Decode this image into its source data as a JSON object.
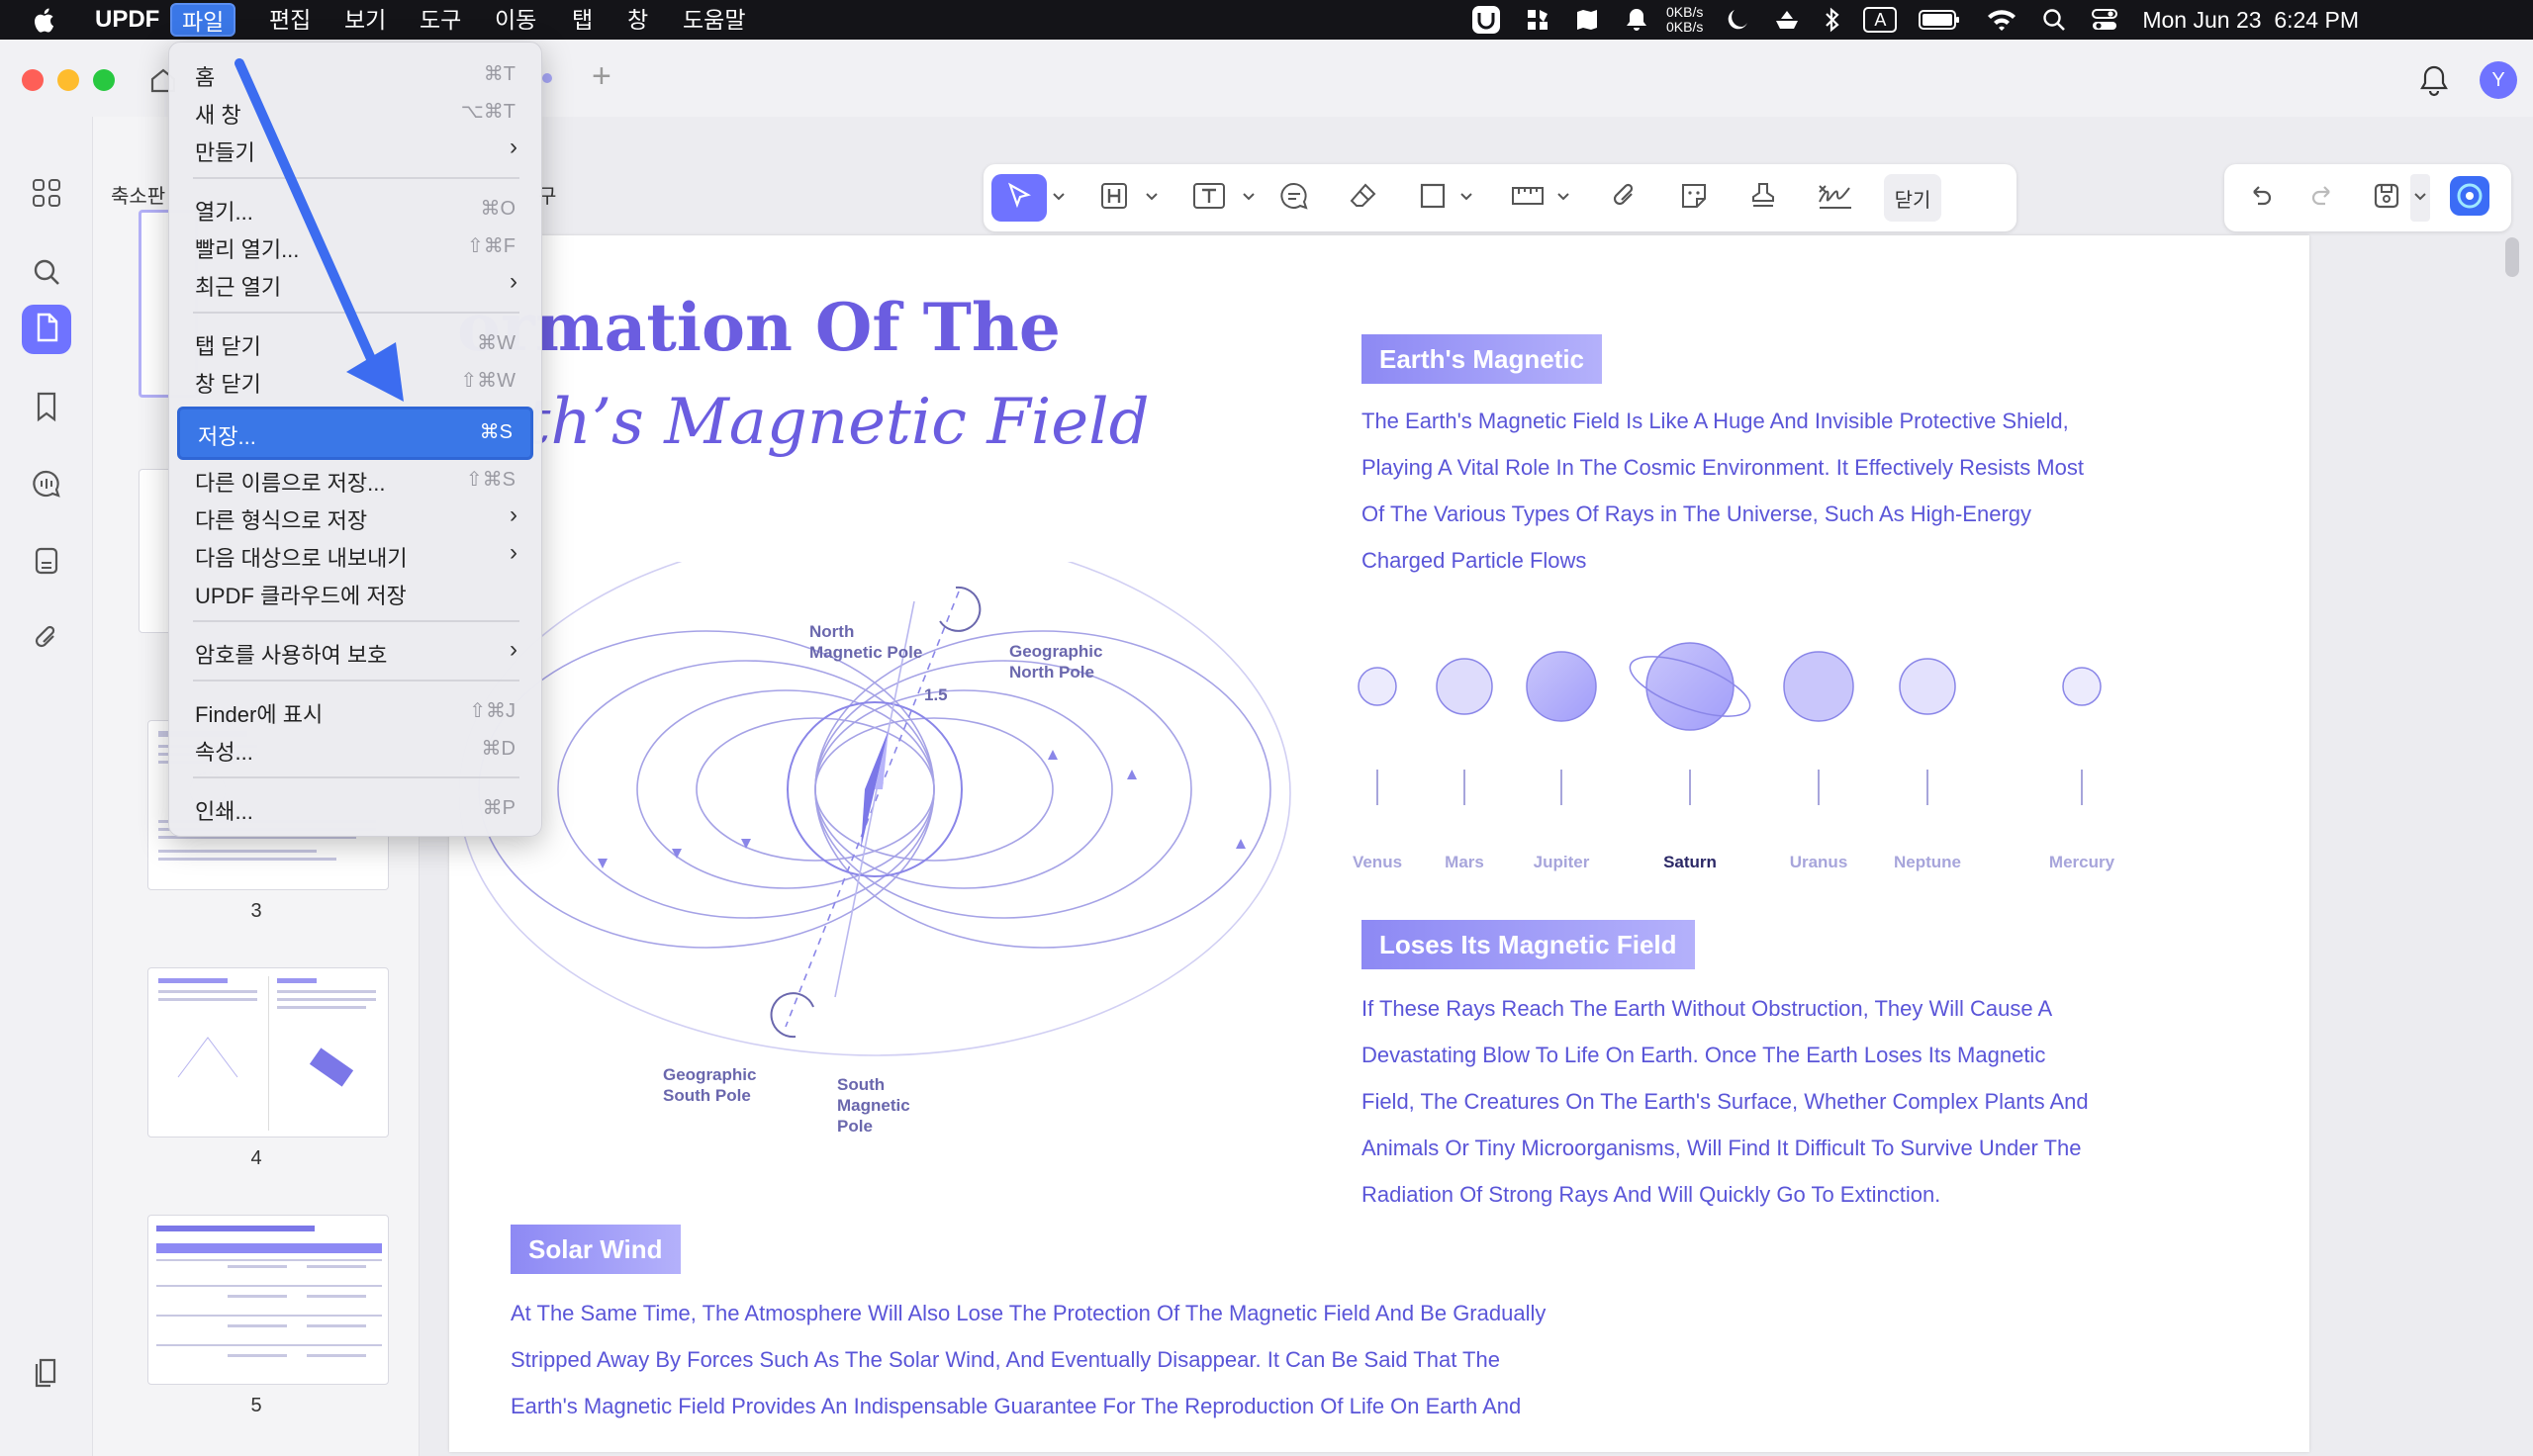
{
  "menubar": {
    "app_name": "UPDF",
    "menus": [
      "파일",
      "편집",
      "보기",
      "도구",
      "이동",
      "탭",
      "창",
      "도움말"
    ],
    "network_up": "0KB/s",
    "network_down": "0KB/s",
    "input_source": "A",
    "clock": "Mon Jun 23  6:24 PM"
  },
  "window": {
    "avatar_letter": "Y",
    "thumbs_label": "축소판",
    "tab_partial_label": "구",
    "toolbar_close_label": "닫기"
  },
  "thumbnails": [
    {
      "page": "3"
    },
    {
      "page": "4"
    },
    {
      "page": "5"
    }
  ],
  "file_menu": {
    "items": [
      {
        "label": "홈",
        "shortcut": "⌘T",
        "submenu": false
      },
      {
        "label": "새 창",
        "shortcut": "⌥⌘T",
        "submenu": false
      },
      {
        "label": "만들기",
        "shortcut": "",
        "submenu": true
      },
      {
        "label": "열기...",
        "shortcut": "⌘O",
        "submenu": false
      },
      {
        "label": "빨리 열기...",
        "shortcut": "⇧⌘F",
        "submenu": false
      },
      {
        "label": "최근 열기",
        "shortcut": "",
        "submenu": true
      },
      {
        "label": "탭 닫기",
        "shortcut": "⌘W",
        "submenu": false
      },
      {
        "label": "창 닫기",
        "shortcut": "⇧⌘W",
        "submenu": false
      },
      {
        "label": "저장...",
        "shortcut": "⌘S",
        "submenu": false,
        "highlighted": true
      },
      {
        "label": "다른 이름으로 저장...",
        "shortcut": "⇧⌘S",
        "submenu": false
      },
      {
        "label": "다른 형식으로 저장",
        "shortcut": "",
        "submenu": true
      },
      {
        "label": "다음 대상으로 내보내기",
        "shortcut": "",
        "submenu": true
      },
      {
        "label": "UPDF 클라우드에 저장",
        "shortcut": "",
        "submenu": false
      },
      {
        "label": "암호를 사용하여 보호",
        "shortcut": "",
        "submenu": true
      },
      {
        "label": "Finder에 표시",
        "shortcut": "⇧⌘J",
        "submenu": false
      },
      {
        "label": "속성...",
        "shortcut": "⌘D",
        "submenu": false
      },
      {
        "label": "인쇄...",
        "shortcut": "⌘P",
        "submenu": false
      }
    ]
  },
  "document": {
    "title_line1": "ormation Of The",
    "title_line2": "arth’s Magnetic Field",
    "section1_tag": "Earth's Magnetic",
    "section1_lines": [
      "The Earth's Magnetic Field Is Like A Huge And Invisible Protective Shield,",
      "Playing A Vital Role In The Cosmic Environment. It Effectively Resists Most",
      "Of The Various Types Of Rays in The Universe, Such As High-Energy",
      "Charged Particle Flows"
    ],
    "planets": [
      "Venus",
      "Mars",
      "Jupiter",
      "Saturn",
      "Uranus",
      "Neptune",
      "Mercury"
    ],
    "section2_tag": "Loses Its Magnetic Field",
    "section2_lines": [
      "If These Rays Reach The Earth Without Obstruction, They Will Cause A",
      "Devastating Blow To Life On Earth. Once The Earth Loses Its Magnetic",
      "Field, The Creatures On The Earth's Surface, Whether Complex Plants And",
      "Animals Or Tiny Microorganisms, Will Find It Difficult To Survive Under The",
      "Radiation Of Strong Rays And Will Quickly Go To Extinction."
    ],
    "section3_tag": "Solar Wind",
    "section3_lines": [
      "At The Same Time, The Atmosphere Will Also Lose The Protection Of The Magnetic Field And Be Gradually",
      "Stripped Away By Forces Such As The Solar Wind, And Eventually Disappear. It Can Be Said That The",
      "Earth's Magnetic Field Provides An Indispensable Guarantee For The Reproduction Of Life On Earth And"
    ],
    "diagram": {
      "north_magnetic_pole": [
        "North",
        "Magnetic Pole"
      ],
      "geographic_north_pole": [
        "Geographic",
        "North Pole"
      ],
      "geographic_south_pole": [
        "Geographic",
        "South Pole"
      ],
      "south_magnetic_pole": [
        "South",
        "Magnetic",
        "Pole"
      ],
      "angle_label": "1.5"
    }
  },
  "colors": {
    "accent": "#6f73ff",
    "menu_highlight": "#3a77e7",
    "doc_text": "#5a55d8"
  }
}
